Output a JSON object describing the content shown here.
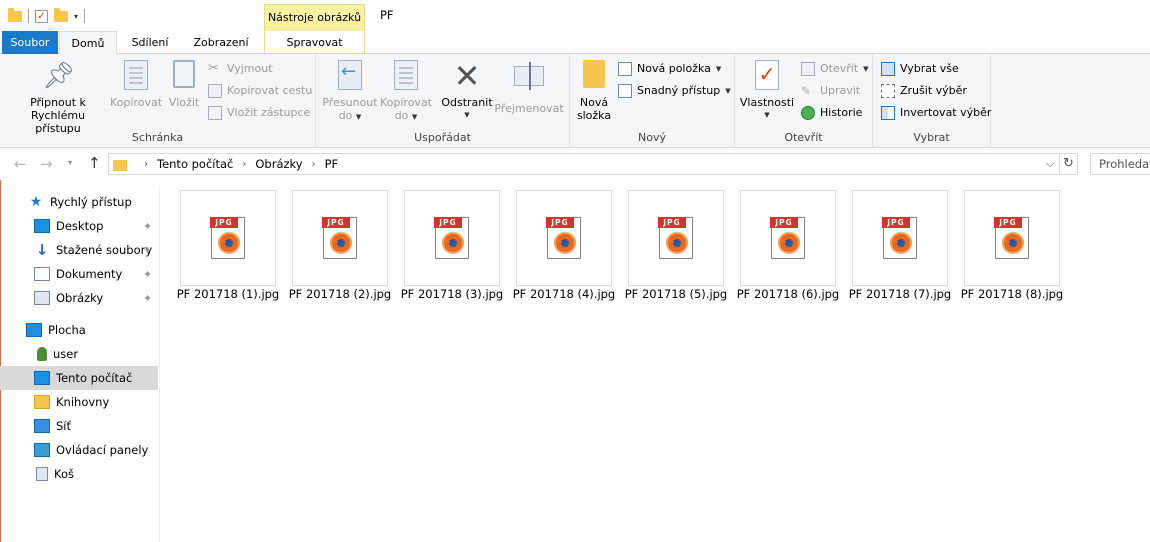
{
  "titlebar": {
    "context_tab": "Nástroje obrázků",
    "title": "PF"
  },
  "tabs": {
    "file": "Soubor",
    "home": "Domů",
    "share": "Sdílení",
    "view": "Zobrazení",
    "manage": "Spravovat"
  },
  "ribbon": {
    "clipboard": {
      "pin_line1": "Připnout k",
      "pin_line2": "Rychlému přístupu",
      "copy": "Kopírovat",
      "paste": "Vložit",
      "cut": "Vyjmout",
      "copy_path": "Kopírovat cestu",
      "paste_shortcut": "Vložit zástupce",
      "label": "Schránka"
    },
    "organize": {
      "move_line1": "Přesunout",
      "move_line2": "do",
      "copyto_line1": "Kopírovat",
      "copyto_line2": "do",
      "delete": "Odstranit",
      "rename": "Přejmenovat",
      "label": "Uspořádat"
    },
    "new": {
      "folder_line1": "Nová",
      "folder_line2": "složka",
      "new_item": "Nová položka",
      "easy_access": "Snadný přístup",
      "label": "Nový"
    },
    "open": {
      "properties": "Vlastnosti",
      "open": "Otevřít",
      "edit": "Upravit",
      "history": "Historie",
      "label": "Otevřít"
    },
    "select": {
      "select_all": "Vybrat vše",
      "select_none": "Zrušit výběr",
      "invert": "Invertovat výběr",
      "label": "Vybrat"
    }
  },
  "address": {
    "crumbs": [
      "Tento počítač",
      "Obrázky",
      "PF"
    ],
    "search_placeholder": "Prohledat"
  },
  "navpane": {
    "quick_access": "Rychlý přístup",
    "quick_items": [
      "Desktop",
      "Stažené soubory",
      "Dokumenty",
      "Obrázky"
    ],
    "tree": [
      "Plocha",
      "user",
      "Tento počítač",
      "Knihovny",
      "Síť",
      "Ovládací panely",
      "Koš"
    ]
  },
  "files": [
    {
      "name": "PF 201718 (1).jpg",
      "tag": "JPG"
    },
    {
      "name": "PF 201718 (2).jpg",
      "tag": "JPG"
    },
    {
      "name": "PF 201718 (3).jpg",
      "tag": "JPG"
    },
    {
      "name": "PF 201718 (4).jpg",
      "tag": "JPG"
    },
    {
      "name": "PF 201718 (5).jpg",
      "tag": "JPG"
    },
    {
      "name": "PF 201718 (6).jpg",
      "tag": "JPG"
    },
    {
      "name": "PF 201718 (7).jpg",
      "tag": "JPG"
    },
    {
      "name": "PF 201718 (8).jpg",
      "tag": "JPG"
    }
  ]
}
